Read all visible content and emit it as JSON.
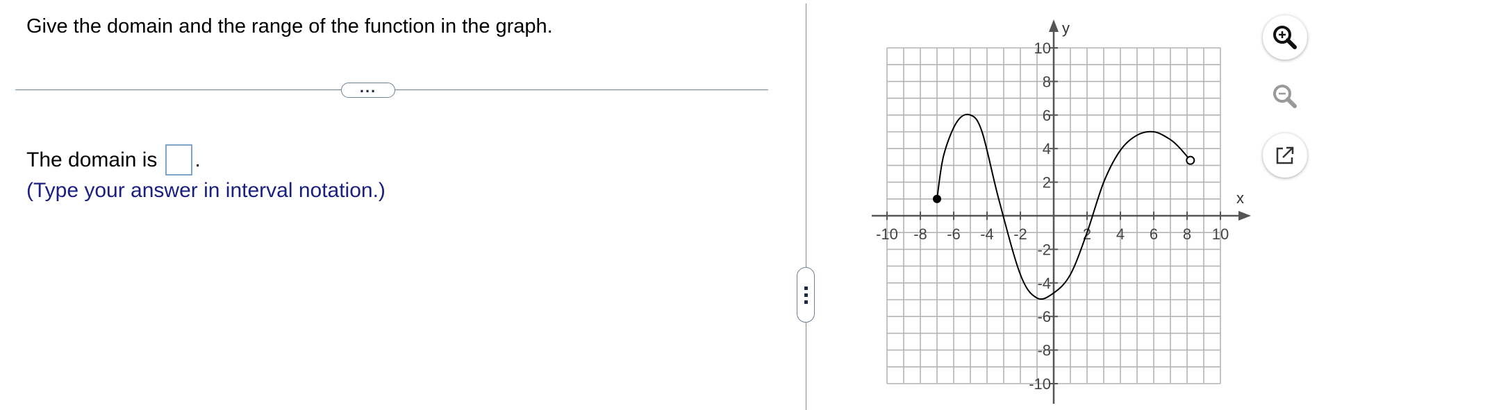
{
  "question": {
    "prompt": "Give the domain and the range of the function in the graph.",
    "expand_label": "..."
  },
  "answer": {
    "domain_prefix": "The domain is",
    "domain_suffix": ".",
    "domain_value": "",
    "hint": "(Type your answer in interval notation.)"
  },
  "graph": {
    "x_axis_label": "x",
    "y_axis_label": "y",
    "xlim": [
      -10,
      10
    ],
    "ylim": [
      -10,
      10
    ],
    "x_ticks": [
      -10,
      -8,
      -6,
      -4,
      -2,
      2,
      4,
      6,
      8,
      10
    ],
    "y_ticks": [
      10,
      8,
      6,
      4,
      2,
      -2,
      -4,
      -6,
      -8,
      -10
    ],
    "tick_labels_x": [
      "-10",
      "-8",
      "-6",
      "-4",
      "-2",
      "2",
      "4",
      "6",
      "8",
      "10"
    ],
    "tick_labels_y": [
      "10",
      "8",
      "6",
      "4",
      "2",
      "-2",
      "-4",
      "-6",
      "-8",
      "-10"
    ],
    "curve_points": [
      [
        -7,
        1
      ],
      [
        -6.6,
        3.6
      ],
      [
        -5.8,
        5.6
      ],
      [
        -5,
        6
      ],
      [
        -4.3,
        5
      ],
      [
        -3.3,
        1
      ],
      [
        -2,
        -3.5
      ],
      [
        -1,
        -4.9
      ],
      [
        0,
        -4.6
      ],
      [
        1,
        -3.5
      ],
      [
        2,
        -1
      ],
      [
        3,
        2
      ],
      [
        4,
        3.9
      ],
      [
        5,
        4.8
      ],
      [
        6,
        5
      ],
      [
        6.9,
        4.6
      ],
      [
        7.5,
        4.1
      ],
      [
        8.2,
        3.3
      ]
    ],
    "closed_endpoint": [
      -7,
      1
    ],
    "open_endpoint": [
      8.2,
      3.3
    ]
  },
  "colors": {
    "hint": "#1a2080",
    "grid": "#b4b4b4",
    "axis": "#555555",
    "curve": "#000000"
  },
  "tools": {
    "zoom_in": "zoom-in-icon",
    "zoom_out": "zoom-out-icon",
    "popout": "popout-icon"
  }
}
